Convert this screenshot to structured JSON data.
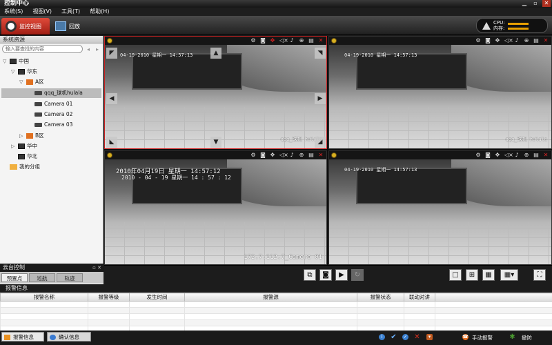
{
  "window": {
    "title": "控制中心",
    "min": "▁",
    "max": "▫",
    "close": "✕"
  },
  "menu": [
    "系统(S)",
    "视图(V)",
    "工具(T)",
    "帮助(H)"
  ],
  "toolbar": {
    "tab_monitor": "监控视图",
    "tab_playback": "回放"
  },
  "sysmon": {
    "cpu": "CPU:",
    "mem": "内存:",
    "cpu_level": 0.55,
    "mem_level": 0.5
  },
  "leftpanel": {
    "title": "系统资源",
    "search_placeholder": "输入要查找的内容",
    "tree": [
      {
        "label": "中国",
        "icon": "pc-icon",
        "toggle": "▽"
      },
      {
        "label": "华东",
        "icon": "pc-icon",
        "toggle": "▽"
      },
      {
        "label": "A区",
        "icon": "home-icon",
        "toggle": "▽"
      },
      {
        "label": "qqq_球机hulala",
        "icon": "camera-icon",
        "toggle": ""
      },
      {
        "label": "Camera 01",
        "icon": "camera-icon",
        "toggle": ""
      },
      {
        "label": "Camera 02",
        "icon": "camera-icon",
        "toggle": ""
      },
      {
        "label": "Camera 03",
        "icon": "camera-icon",
        "toggle": ""
      },
      {
        "label": "B区",
        "icon": "home-icon",
        "toggle": "▷"
      },
      {
        "label": "华中",
        "icon": "pc-icon",
        "toggle": "▷"
      },
      {
        "label": "华北",
        "icon": "pc-icon",
        "toggle": ""
      },
      {
        "label": "我的分组",
        "icon": "folder-icon",
        "toggle": ""
      }
    ]
  },
  "panes": [
    {
      "ts": "04-19-2010 星期一 14:57:13",
      "caption": "qqq_球机 hulala"
    },
    {
      "ts": "04-19-2010 星期一 14:57:13",
      "caption": "qqq_球机 hulala"
    },
    {
      "ts": "2010年04月19日 星期一 14:57:12",
      "ts2": "2010 - 04 - 19  星期一 14 : 57 : 12",
      "caption": "172.7.112.7_Camera 01"
    },
    {
      "ts": "04-19-2010 星期一 14:57:13",
      "caption": ""
    }
  ],
  "ptz": {
    "title": "云台控制",
    "tabs": [
      "预置点",
      "巡航",
      "轨迹"
    ]
  },
  "alarm": {
    "title": "报警信息",
    "columns": [
      "报警名称",
      "报警等级",
      "发生时间",
      "报警源",
      "报警状态",
      "联动对讲"
    ]
  },
  "statusbar": {
    "tab1": "报警信息",
    "tab2": "确认信息",
    "manual_alarm": "手动报警",
    "defense": "撤防"
  }
}
